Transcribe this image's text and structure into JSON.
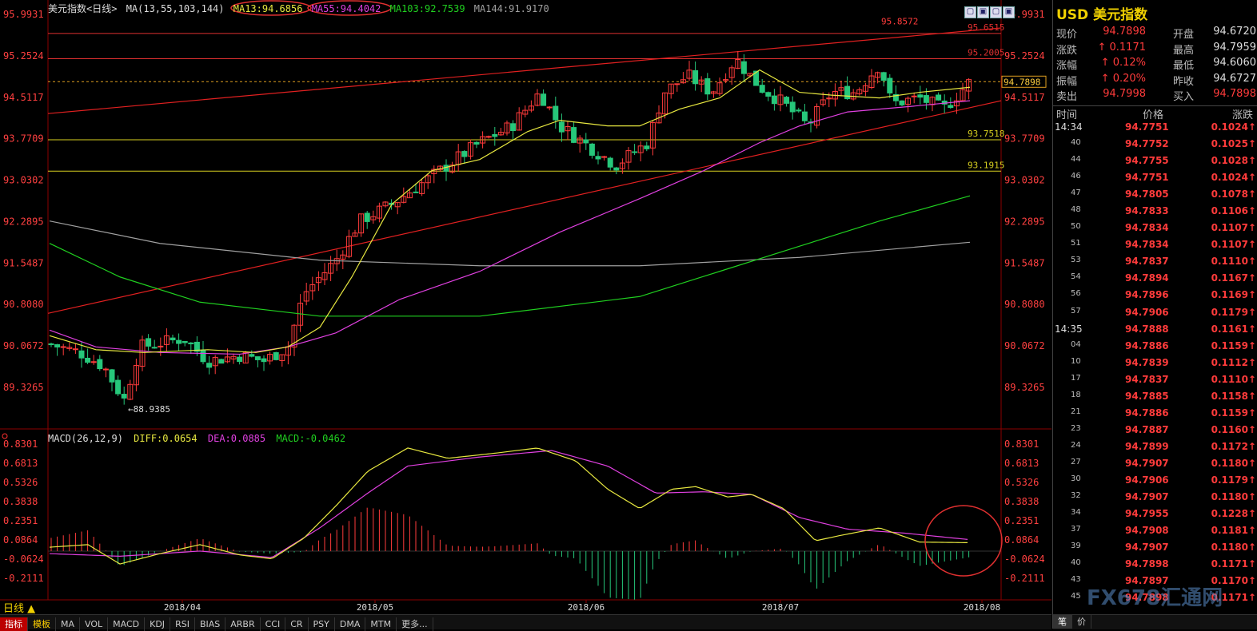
{
  "window": {
    "symbol_title": "美元指数<日线>",
    "buttons": [
      "▢",
      "▣",
      "▢",
      "▣"
    ]
  },
  "ma_legend": {
    "label": "MA(13,55,103,144)",
    "ma13": "MA13:94.6856",
    "ma55": "MA55:94.4042",
    "ma103": "MA103:92.7539",
    "ma144": "MA144:91.9170"
  },
  "macd_legend": {
    "label": "MACD(26,12,9)",
    "diff": "DIFF:0.0654",
    "dea": "DEA:0.0885",
    "macd": "MACD:-0.0462"
  },
  "price_axis_left": [
    "95.9931",
    "95.2524",
    "94.5117",
    "93.7709",
    "93.0302",
    "92.2895",
    "91.5487",
    "90.8080",
    "90.0672",
    "89.3265"
  ],
  "price_axis_right": [
    "95.9931",
    "95.2524",
    "94.5117",
    "93.7709",
    "93.0302",
    "92.2895",
    "91.5487",
    "90.8080",
    "90.0672",
    "89.3265"
  ],
  "macd_axis": [
    "0.8301",
    "0.6813",
    "0.5326",
    "0.3838",
    "0.2351",
    "0.0864",
    "-0.0624",
    "-0.2111"
  ],
  "hlines": [
    {
      "label": "95.6515",
      "value": 95.6515,
      "color": "#e03030"
    },
    {
      "label": "95.2005",
      "value": 95.2005,
      "color": "#e03030"
    },
    {
      "label": "93.7518",
      "value": 93.7518,
      "color": "#d8d020"
    },
    {
      "label": "93.1915",
      "value": 93.1915,
      "color": "#d8d020"
    }
  ],
  "annotations": {
    "high": "95.8572",
    "low": "88.9385",
    "last_price": "94.7898"
  },
  "dates": [
    "2018/04",
    "2018/05",
    "2018/06",
    "2018/07",
    "2018/08"
  ],
  "period_label": "日线 ▲",
  "tabs": [
    "指标",
    "模板",
    "MA",
    "VOL",
    "MACD",
    "KDJ",
    "RSI",
    "BIAS",
    "ARBR",
    "CCI",
    "CR",
    "PSY",
    "DMA",
    "MTM",
    "更多..."
  ],
  "quote": {
    "title": "USD 美元指数",
    "rows": [
      {
        "l": "现价",
        "v": "94.7898",
        "l2": "开盘",
        "v2": "94.6720"
      },
      {
        "l": "涨跌",
        "v": "↑ 0.1171",
        "l2": "最高",
        "v2": "94.7959"
      },
      {
        "l": "涨幅",
        "v": "↑ 0.12%",
        "l2": "最低",
        "v2": "94.6060"
      },
      {
        "l": "振幅",
        "v": "↑ 0.20%",
        "l2": "昨收",
        "v2": "94.6727"
      },
      {
        "l": "卖出",
        "v": "94.7998",
        "l2": "买入",
        "v2": "94.7898"
      }
    ],
    "table_head": [
      "时间",
      "价格",
      "涨跌"
    ],
    "ticks": [
      {
        "t": "14:34",
        "p": "94.7751",
        "c": "0.1024↑"
      },
      {
        "t": "40",
        "p": "94.7752",
        "c": "0.1025↑"
      },
      {
        "t": "44",
        "p": "94.7755",
        "c": "0.1028↑"
      },
      {
        "t": "46",
        "p": "94.7751",
        "c": "0.1024↑"
      },
      {
        "t": "47",
        "p": "94.7805",
        "c": "0.1078↑"
      },
      {
        "t": "48",
        "p": "94.7833",
        "c": "0.1106↑"
      },
      {
        "t": "50",
        "p": "94.7834",
        "c": "0.1107↑"
      },
      {
        "t": "51",
        "p": "94.7834",
        "c": "0.1107↑"
      },
      {
        "t": "53",
        "p": "94.7837",
        "c": "0.1110↑"
      },
      {
        "t": "54",
        "p": "94.7894",
        "c": "0.1167↑"
      },
      {
        "t": "56",
        "p": "94.7896",
        "c": "0.1169↑"
      },
      {
        "t": "57",
        "p": "94.7906",
        "c": "0.1179↑"
      },
      {
        "t": "14:35",
        "p": "94.7888",
        "c": "0.1161↑"
      },
      {
        "t": "04",
        "p": "94.7886",
        "c": "0.1159↑"
      },
      {
        "t": "10",
        "p": "94.7839",
        "c": "0.1112↑"
      },
      {
        "t": "17",
        "p": "94.7837",
        "c": "0.1110↑"
      },
      {
        "t": "18",
        "p": "94.7885",
        "c": "0.1158↑"
      },
      {
        "t": "21",
        "p": "94.7886",
        "c": "0.1159↑"
      },
      {
        "t": "23",
        "p": "94.7887",
        "c": "0.1160↑"
      },
      {
        "t": "24",
        "p": "94.7899",
        "c": "0.1172↑"
      },
      {
        "t": "27",
        "p": "94.7907",
        "c": "0.1180↑"
      },
      {
        "t": "30",
        "p": "94.7906",
        "c": "0.1179↑"
      },
      {
        "t": "32",
        "p": "94.7907",
        "c": "0.1180↑"
      },
      {
        "t": "34",
        "p": "94.7955",
        "c": "0.1228↑"
      },
      {
        "t": "37",
        "p": "94.7908",
        "c": "0.1181↑"
      },
      {
        "t": "39",
        "p": "94.7907",
        "c": "0.1180↑"
      },
      {
        "t": "40",
        "p": "94.7898",
        "c": "0.1171↑"
      },
      {
        "t": "43",
        "p": "94.7897",
        "c": "0.1170↑"
      },
      {
        "t": "45",
        "p": "94.7898",
        "c": "0.1171↑"
      }
    ],
    "footer_tabs": [
      "笔",
      "价"
    ]
  },
  "watermark": "FX678汇通网",
  "colors": {
    "up": "#ff3b3b",
    "down": "#26c77a",
    "ma13": "#e8e840",
    "ma55": "#e040e0",
    "ma103": "#20d020",
    "ma144": "#a0a0a0",
    "accent": "#f0d000"
  },
  "chart_data": {
    "type": "candlestick",
    "ylim": [
      88.8,
      96.1
    ],
    "x": [
      "2018/04",
      "2018/05",
      "2018/06",
      "2018/07",
      "2018/08"
    ],
    "series": [
      {
        "name": "MA13",
        "values": [
          90.2,
          90.0,
          90.0,
          89.9,
          90.1,
          91.0,
          92.3,
          93.5,
          94.1,
          94.0,
          93.9,
          94.3,
          94.8,
          94.6,
          94.5,
          94.6,
          94.6,
          94.7
        ]
      },
      {
        "name": "MA55",
        "values": [
          90.3,
          90.0,
          89.95,
          89.9,
          89.95,
          90.3,
          90.9,
          91.6,
          92.3,
          93.1,
          93.6,
          94.1,
          94.3,
          94.35,
          94.4
        ]
      },
      {
        "name": "MA103",
        "values": [
          92.0,
          91.2,
          90.6,
          90.4,
          90.4,
          90.6,
          91.1,
          91.6,
          92.0,
          92.4,
          92.75
        ]
      },
      {
        "name": "MA144",
        "values": [
          92.2,
          91.7,
          91.6,
          91.6,
          91.7,
          91.9
        ]
      },
      {
        "name": "DIFF",
        "values": [
          0.03,
          -0.1,
          0.0,
          -0.05,
          0.3,
          0.65,
          0.8,
          0.74,
          0.78,
          0.66,
          0.35,
          0.48,
          0.45,
          0.25,
          0.1,
          0.18,
          0.07,
          0.065
        ]
      },
      {
        "name": "DEA",
        "values": [
          0.0,
          -0.05,
          -0.03,
          -0.05,
          0.15,
          0.55,
          0.74,
          0.77,
          0.79,
          0.7,
          0.48,
          0.46,
          0.4,
          0.22,
          0.15,
          0.12,
          0.09,
          0.0885
        ]
      }
    ]
  }
}
